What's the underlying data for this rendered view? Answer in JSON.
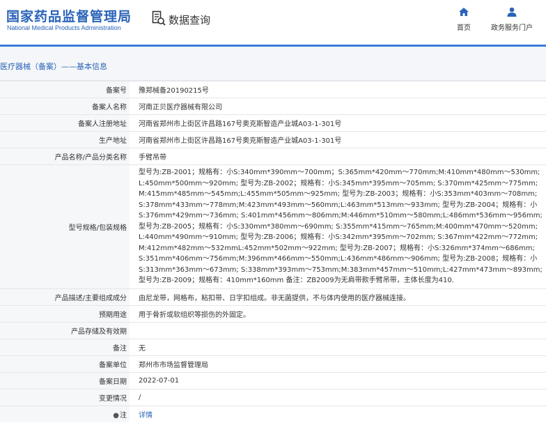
{
  "header": {
    "logo_cn": "国家药品监督管理局",
    "logo_en": "National Medical Products Administration",
    "query_label": "数据查询",
    "nav": [
      {
        "label": "首页",
        "icon": "home-icon"
      },
      {
        "label": "政务服务门户",
        "icon": "user-icon"
      }
    ],
    "accent_color": "#2a63b8"
  },
  "breadcrumb": "医疗器械（备案）——基本信息",
  "rows": [
    {
      "label": "备案号",
      "value": "豫郑械备20190215号"
    },
    {
      "label": "备案人名称",
      "value": "河南正贝医疗器械有限公司"
    },
    {
      "label": "备案人注册地址",
      "value": "河南省郑州市上街区许昌路167号奥克斯智造产业城A03-1-301号"
    },
    {
      "label": "生产地址",
      "value": "河南省郑州市上街区许昌路167号奥克斯智造产业城A03-1-301号"
    },
    {
      "label": "产品名称/产品分类名称",
      "value": "手臂吊带"
    },
    {
      "label": "型号规格/包装规格",
      "value": "型号为:ZB-2001；规格有：小S:340mm*390mm～700mm；S:365mm*420mm～770mm;M:410mm*480mm～530mm;L:450mm*500mm～920mm; 型号为:ZB-2002；规格有：小S:345mm*395mm～705mm; S:370mm*425mm～775mm;M:415mm*485mm～545mm;L:455mm*505mm～925mm; 型号为:ZB-2003；规格有：小S:353mm*403mm～708mm; S:378mm*433mm～778mm;M:423mm*493mm～560mm;L:463mm*513mm～933mm; 型号为:ZB-2004；规格有：小S:376mm*429mm～736mm; S:401mm*456mm～806mm;M:446mm*510mm～580mm;L:486mm*536mm～956mm; 型号为:ZB-2005；规格有：小S:330mm*380mm～690mm; S:355mm*415mm～765mm;M:400mm*470mm～520mm;L:440mm*490mm～910mm; 型号为:ZB-2006；规格有：小S:342mm*395mm～702mm; S:367mm*422mm～772mm;M:412mm*482mm～532mmL:452mm*502mm～922mm; 型号为:ZB-2007；规格有：小S:326mm*374mm～686mm; S:351mm*406mm～756mm;M:396mm*466mm～550mm;L:436mm*486mm～906mm; 型号为:ZB-2008；规格有：小S:313mm*363mm～673mm; S:338mm*393mm～753mm;M:383mm*457mm～510mm;L:427mm*473mm～893mm; 型号为:ZB-2009；规格有：410mm*160mm 备注：ZB2009为无肩带款手臂吊带，主体长度为410."
    },
    {
      "label": "产品描述/主要组成成分",
      "value": "由尼龙带，网格布，粘扣带、日字扣组成。非无菌提供，不与体内使用的医疗器械连接。"
    },
    {
      "label": "预期用途",
      "value": "用于骨折或软组织等损伤的外固定。"
    },
    {
      "label": "产品存储及有效期",
      "value": ""
    },
    {
      "label": "备注",
      "value": "无"
    },
    {
      "label": "备案单位",
      "value": "郑州市市场监督管理局"
    },
    {
      "label": "备案日期",
      "value": "2022-07-01"
    },
    {
      "label": "变更情况",
      "value": "/"
    },
    {
      "label": "注",
      "value": "详情"
    }
  ]
}
